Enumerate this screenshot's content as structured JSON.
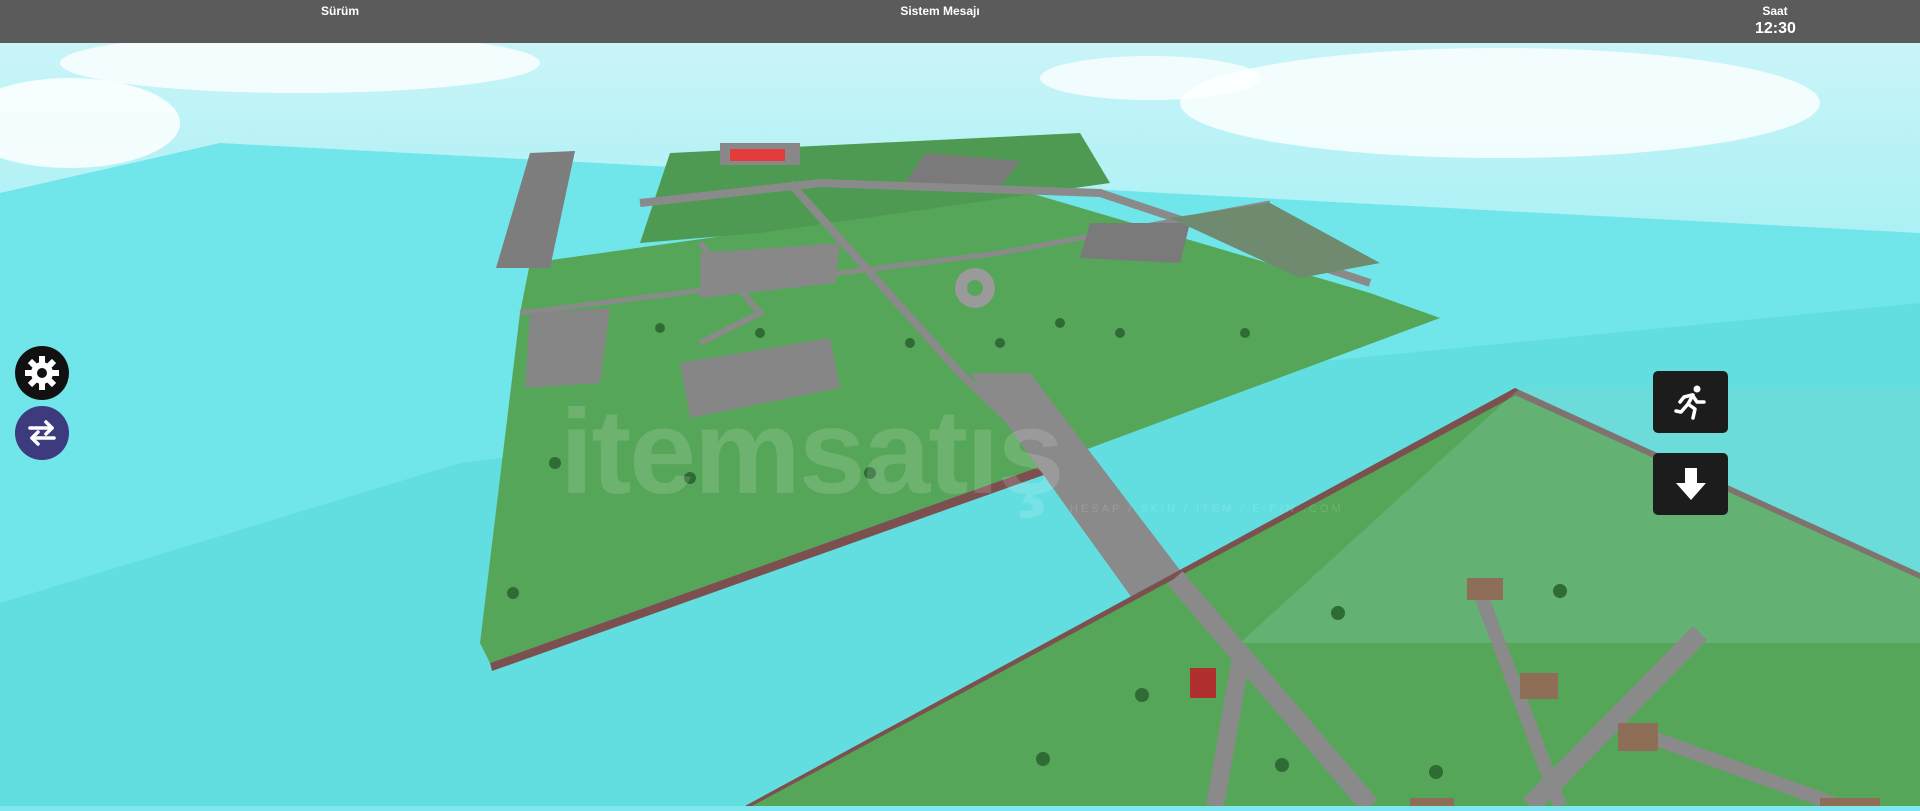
{
  "topbar": {
    "version_label": "Sürüm",
    "system_message_label": "Sistem Mesajı",
    "clock_label": "Saat",
    "clock_time": "12:30"
  },
  "watermark": {
    "logo": "itemsatış",
    "tagline": "HESAP / SKIN / ITEM / E-PIN .COM"
  },
  "controls": {
    "settings_icon": "gear-icon",
    "switch_icon": "swap-arrows-icon",
    "run_icon": "running-person-icon",
    "descend_icon": "arrow-down-icon"
  },
  "colors": {
    "sky": "#7fe8ee",
    "water": "#60dfe0",
    "grass": "#56a659",
    "road": "#8a8a8a",
    "topbar": "#5b5b5b",
    "switch_button": "#3d3a7e"
  }
}
